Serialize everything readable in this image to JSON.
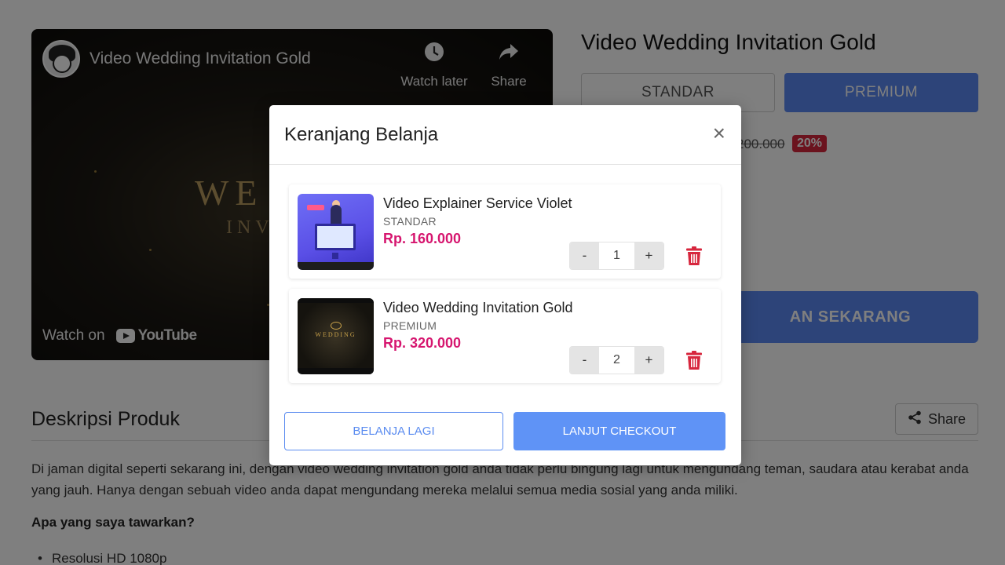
{
  "video": {
    "title": "Video Wedding Invitation Gold",
    "watch_later": "Watch later",
    "share": "Share",
    "watch_on": "Watch on",
    "youtube": "YouTube",
    "overlay_text_1": "WE",
    "overlay_text_2": "INV"
  },
  "product": {
    "title": "Video Wedding Invitation Gold",
    "tabs": [
      {
        "label": "STANDAR",
        "active": false
      },
      {
        "label": "PREMIUM",
        "active": true
      }
    ],
    "old_price": "200.000",
    "discount": "20%",
    "buy_button": "AN SEKARANG"
  },
  "description": {
    "heading": "Deskripsi Produk",
    "share": "Share",
    "paragraph": "Di jaman digital seperti sekarang ini, dengan video wedding invitation gold anda tidak perlu bingung lagi untuk mengundang teman, saudara atau kerabat anda yang jauh. Hanya dengan sebuah video anda dapat mengundang mereka melalui semua media sosial yang anda miliki.",
    "offer_heading": "Apa yang saya tawarkan?",
    "bullets": [
      "Resolusi HD 1080p"
    ]
  },
  "cart": {
    "title": "Keranjang Belanja",
    "close": "×",
    "items": [
      {
        "name": "Video Explainer Service Violet",
        "variant": "STANDAR",
        "price": "Rp. 160.000",
        "minus": "-",
        "qty": "1",
        "plus": "+"
      },
      {
        "name": "Video Wedding Invitation Gold",
        "variant": "PREMIUM",
        "price": "Rp. 320.000",
        "minus": "-",
        "qty": "2",
        "plus": "+"
      }
    ],
    "continue_shopping": "BELANJA LAGI",
    "checkout": "LANJUT CHECKOUT"
  },
  "colors": {
    "primary": "#5b88f2",
    "price": "#d6166f",
    "danger": "#d7263d"
  }
}
